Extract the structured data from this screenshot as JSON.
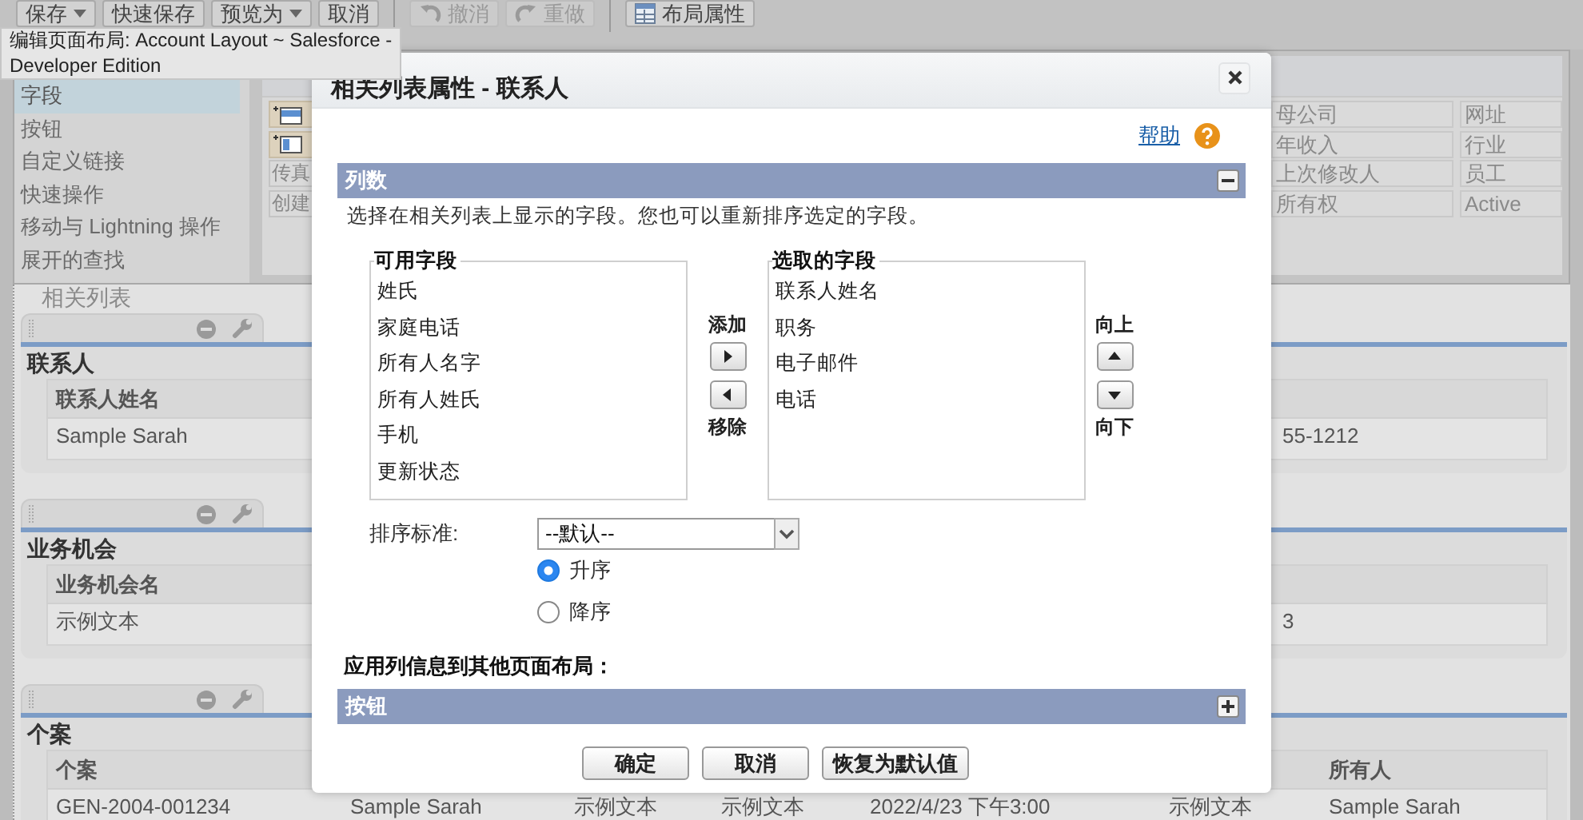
{
  "tooltip": {
    "text": "编辑页面布局: Account Layout ~ Salesforce - Developer Edition"
  },
  "toolbar": [
    [
      {
        "label": "保存",
        "kind": "menu",
        "disabled": false
      },
      {
        "label": "快速保存",
        "kind": "plain",
        "disabled": false
      },
      {
        "label": "预览为",
        "kind": "menu",
        "disabled": false
      },
      {
        "label": "取消",
        "kind": "plain",
        "disabled": false
      }
    ],
    [
      {
        "label": "撤消",
        "kind": "undo",
        "disabled": true
      },
      {
        "label": "重做",
        "kind": "redo",
        "disabled": true
      }
    ],
    [
      {
        "label": "布局属性",
        "kind": "layout",
        "disabled": false
      }
    ]
  ],
  "palette": {
    "categories": [
      {
        "label": "字段",
        "selected": true
      },
      {
        "label": "按钮",
        "selected": false
      },
      {
        "label": "自定义链接",
        "selected": false
      },
      {
        "label": "快速操作",
        "selected": false
      },
      {
        "label": "移动与 Lightning 操作",
        "selected": false
      },
      {
        "label": "展开的查找",
        "selected": false
      }
    ],
    "tiles": [
      {
        "kind": "section"
      },
      {
        "kind": "blank"
      },
      {
        "kind": "field",
        "label": "传真"
      },
      {
        "kind": "field",
        "label": "创建"
      }
    ],
    "fields": [
      [
        "母公司",
        "网址"
      ],
      [
        "年收入",
        "行业"
      ],
      [
        "上次修改人",
        "员工"
      ],
      [
        "所有权",
        "Active"
      ]
    ]
  },
  "related_lists": {
    "heading": "相关列表",
    "lists": [
      {
        "title": "联系人",
        "columns": [
          {
            "header": "联系人姓名",
            "value": "Sample Sarah"
          },
          {
            "value": "55-1212"
          }
        ]
      },
      {
        "title": "业务机会",
        "columns": [
          {
            "header": "业务机会名",
            "value": "示例文本"
          },
          {
            "value": "3"
          }
        ]
      },
      {
        "title": "个案",
        "columns": [
          {
            "header": "个案",
            "value": "GEN-2004-001234"
          },
          {
            "value": "Sample Sarah"
          },
          {
            "value": "示例文本"
          },
          {
            "value": "示例文本"
          },
          {
            "value": "2022/4/23 下午3:00"
          },
          {
            "value": "示例文本"
          },
          {
            "header": "所有人",
            "value": "Sample Sarah"
          }
        ]
      }
    ]
  },
  "dialog": {
    "title": "相关列表属性 - 联系人",
    "help": "帮助",
    "columns_section": {
      "title": "列数",
      "expanded": true,
      "instruction": "选择在相关列表上显示的字段。您也可以重新排序选定的字段。",
      "available": {
        "label": "可用字段",
        "options": [
          "姓氏",
          "家庭电话",
          "所有人名字",
          "所有人姓氏",
          "手机",
          "更新状态"
        ]
      },
      "add": "添加",
      "remove": "移除",
      "chosen": {
        "label": "选取的字段",
        "options": [
          "联系人姓名",
          "职务",
          "电子邮件",
          "电话"
        ]
      },
      "up": "向上",
      "down": "向下",
      "sort": {
        "label": "排序标准:",
        "value": "--默认--",
        "orders": [
          {
            "label": "升序",
            "selected": true
          },
          {
            "label": "降序",
            "selected": false
          }
        ]
      },
      "apply_label": "应用列信息到其他页面布局："
    },
    "buttons_section": {
      "title": "按钮",
      "expanded": false
    },
    "actions": [
      "确定",
      "取消",
      "恢复为默认值"
    ]
  }
}
